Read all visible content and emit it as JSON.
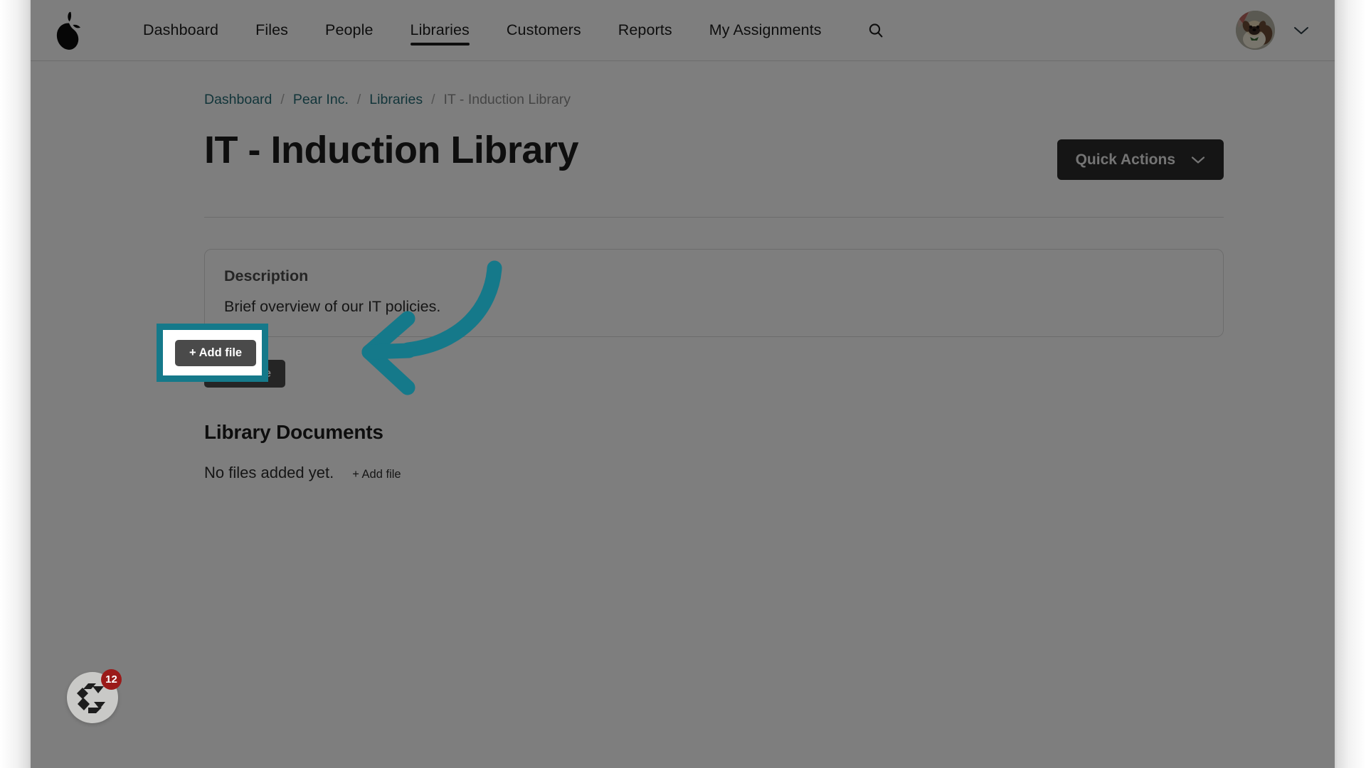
{
  "brand": {
    "logo_icon": "pear-logo"
  },
  "nav": {
    "items": [
      {
        "label": "Dashboard",
        "active": false
      },
      {
        "label": "Files",
        "active": false
      },
      {
        "label": "People",
        "active": false
      },
      {
        "label": "Libraries",
        "active": true
      },
      {
        "label": "Customers",
        "active": false
      },
      {
        "label": "Reports",
        "active": false
      },
      {
        "label": "My Assignments",
        "active": false
      }
    ],
    "search_icon": "search-icon",
    "avatar_icon": "user-avatar-dog",
    "caret_icon": "chevron-down-icon"
  },
  "breadcrumb": {
    "separator": "/",
    "items": [
      {
        "label": "Dashboard",
        "current": false
      },
      {
        "label": "Pear Inc.",
        "current": false
      },
      {
        "label": "Libraries",
        "current": false
      },
      {
        "label": "IT - Induction Library",
        "current": true
      }
    ]
  },
  "header": {
    "title": "IT - Induction Library",
    "quick_actions_label": "Quick Actions",
    "quick_actions_caret": "chevron-down-icon"
  },
  "description_card": {
    "label": "Description",
    "text": "Brief overview of our IT policies."
  },
  "actions": {
    "add_file_label": "+ Add file"
  },
  "documents": {
    "section_title": "Library Documents",
    "empty_text": "No files added yet.",
    "add_file_link_label": "+ Add file"
  },
  "support_widget": {
    "badge_count": "12",
    "logo_icon": "chameleon-logo-icon"
  },
  "colors": {
    "accent_teal": "#15798a",
    "link_teal": "#246a75",
    "dark_button": "#2a2a2a",
    "add_button": "#4a4a4a",
    "badge_red": "#9b1a19",
    "page_bg": "#fdfdfd"
  }
}
